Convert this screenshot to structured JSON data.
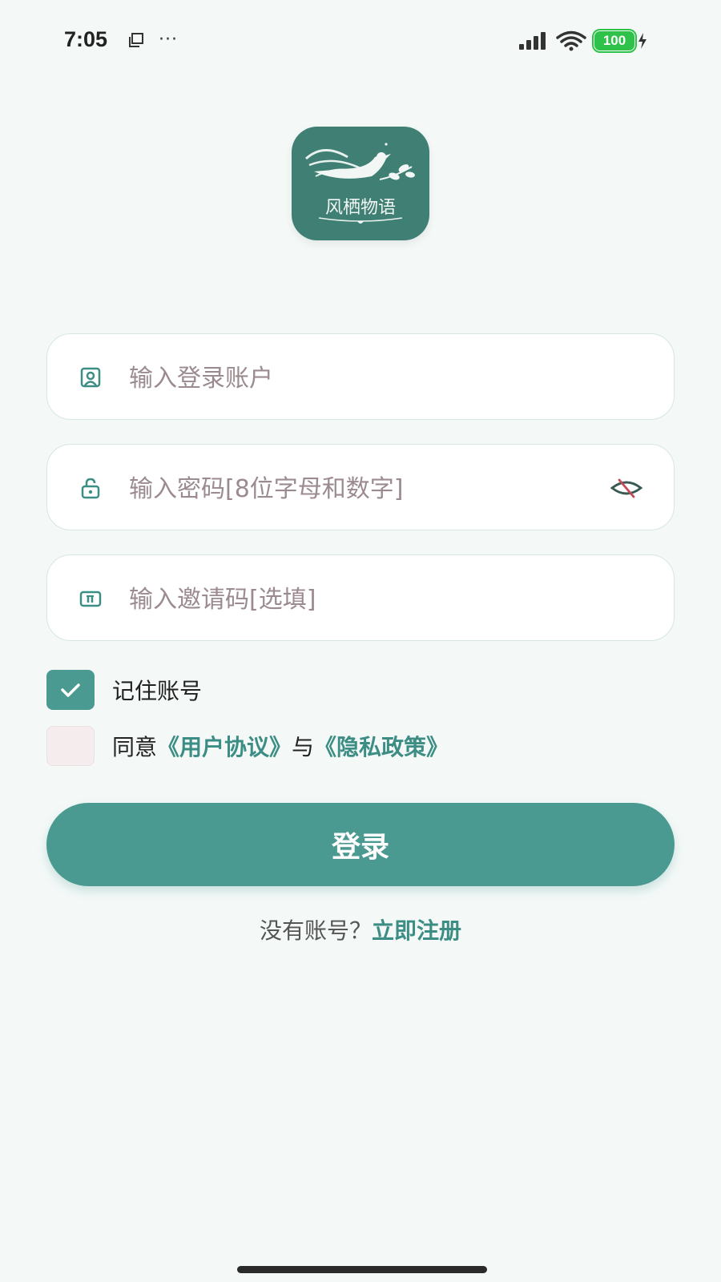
{
  "status_bar": {
    "time": "7:05",
    "more": "···",
    "battery": "100",
    "battery_color": "#2fc24a"
  },
  "app": {
    "name": "风栖物语",
    "brand_color": "#4a9a91"
  },
  "form": {
    "account": {
      "placeholder": "输入登录账户",
      "value": "",
      "icon": "user-card-icon"
    },
    "password": {
      "placeholder": "输入密码[8位字母和数字]",
      "value": "",
      "icon": "lock-icon",
      "toggle_icon": "eye-hidden-icon"
    },
    "invite": {
      "placeholder": "输入邀请码[选填]",
      "value": "",
      "icon": "ticket-icon"
    }
  },
  "remember": {
    "label": "记住账号",
    "checked": true
  },
  "agreement": {
    "prefix": "同意",
    "user_agreement": "《用户协议》",
    "conjunction": "与",
    "privacy_policy": "《隐私政策》",
    "checked": false
  },
  "login_button": {
    "label": "登录"
  },
  "register": {
    "prompt": "没有账号？",
    "link": "立即注册"
  }
}
